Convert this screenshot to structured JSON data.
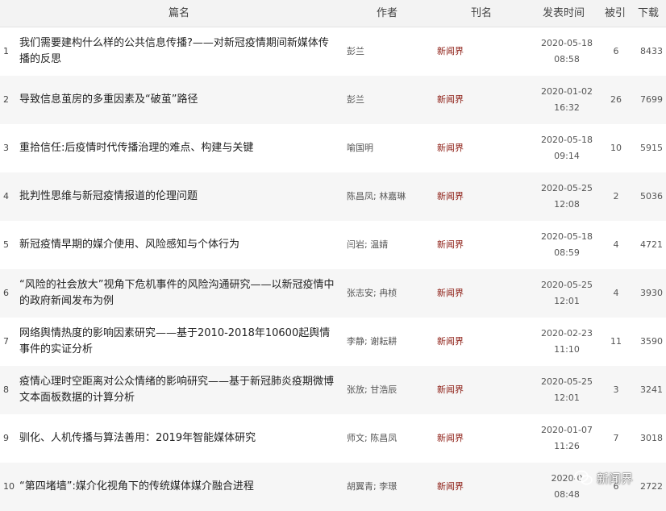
{
  "header": {
    "title": "篇名",
    "author": "作者",
    "journal": "刊名",
    "date": "发表时间",
    "cited": "被引",
    "downloads": "下载"
  },
  "rows": [
    {
      "num": "1",
      "title": "我们需要建构什么样的公共信息传播?——对新冠疫情期间新媒体传播的反思",
      "author": "彭兰",
      "journal": "新闻界",
      "date": "2020-05-18",
      "time": "08:58",
      "cited": "6",
      "downloads": "8433"
    },
    {
      "num": "2",
      "title": "导致信息茧房的多重因素及“破茧”路径",
      "author": "彭兰",
      "journal": "新闻界",
      "date": "2020-01-02",
      "time": "16:32",
      "cited": "26",
      "downloads": "7699"
    },
    {
      "num": "3",
      "title": "重拾信任:后疫情时代传播治理的难点、构建与关键",
      "author": "喻国明",
      "journal": "新闻界",
      "date": "2020-05-18",
      "time": "09:14",
      "cited": "10",
      "downloads": "5915"
    },
    {
      "num": "4",
      "title": "批判性思维与新冠疫情报道的伦理问题",
      "author": "陈昌凤; 林嘉琳",
      "journal": "新闻界",
      "date": "2020-05-25",
      "time": "12:08",
      "cited": "2",
      "downloads": "5036"
    },
    {
      "num": "5",
      "title": "新冠疫情早期的媒介使用、风险感知与个体行为",
      "author": "闫岩; 温婧",
      "journal": "新闻界",
      "date": "2020-05-18",
      "time": "08:59",
      "cited": "4",
      "downloads": "4721"
    },
    {
      "num": "6",
      "title": "“风险的社会放大”视角下危机事件的风险沟通研究——以新冠疫情中的政府新闻发布为例",
      "author": "张志安; 冉桢",
      "journal": "新闻界",
      "date": "2020-05-25",
      "time": "12:01",
      "cited": "4",
      "downloads": "3930"
    },
    {
      "num": "7",
      "title": "网络舆情热度的影响因素研究——基于2010-2018年10600起舆情事件的实证分析",
      "author": "李静; 谢耘耕",
      "journal": "新闻界",
      "date": "2020-02-23",
      "time": "11:10",
      "cited": "11",
      "downloads": "3590"
    },
    {
      "num": "8",
      "title": "疫情心理时空距离对公众情绪的影响研究——基于新冠肺炎疫期微博文本面板数据的计算分析",
      "author": "张放; 甘浩辰",
      "journal": "新闻界",
      "date": "2020-05-25",
      "time": "12:01",
      "cited": "3",
      "downloads": "3241"
    },
    {
      "num": "9",
      "title": "驯化、人机传播与算法善用：2019年智能媒体研究",
      "author": "师文; 陈昌凤",
      "journal": "新闻界",
      "date": "2020-01-07",
      "time": "11:26",
      "cited": "7",
      "downloads": "3018"
    },
    {
      "num": "10",
      "title": "“第四堵墙”:媒介化视角下的传统媒体媒介融合进程",
      "author": "胡翼青; 李璟",
      "journal": "新闻界",
      "date": "2020-0",
      "time": "08:48",
      "cited": "6",
      "downloads": "2722"
    }
  ],
  "watermark": {
    "icon": "wechat-icon",
    "text": "新闻界"
  }
}
